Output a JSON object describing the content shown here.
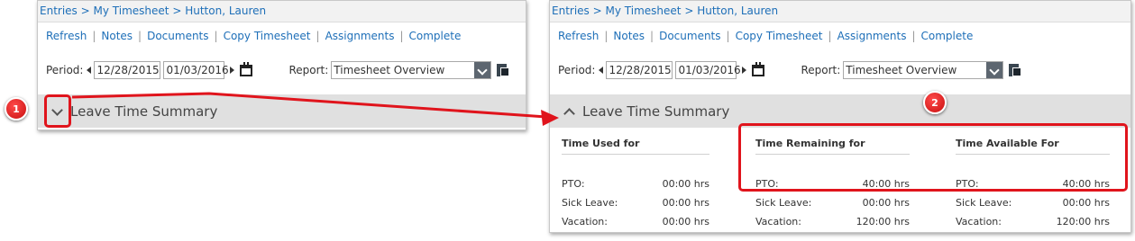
{
  "breadcrumb": {
    "entries": "Entries",
    "sep": ">",
    "my_timesheet": "My Timesheet",
    "person": "Hutton, Lauren"
  },
  "nav_links": [
    "Refresh",
    "Notes",
    "Documents",
    "Copy Timesheet",
    "Assignments",
    "Complete"
  ],
  "nav_separator": "|",
  "period": {
    "label": "Period:",
    "start": "12/28/2015",
    "end": "01/03/2016"
  },
  "report": {
    "label": "Report:",
    "selected": "Timesheet Overview"
  },
  "section": {
    "title": "Leave Time Summary",
    "collapsed_state_left": "collapsed",
    "expanded_state_right": "expanded"
  },
  "summary": {
    "columns": [
      {
        "heading": "Time Used for",
        "rows": [
          {
            "label": "PTO:",
            "value": "00:00 hrs"
          },
          {
            "label": "Sick Leave:",
            "value": "00:00 hrs"
          },
          {
            "label": "Vacation:",
            "value": "00:00 hrs"
          }
        ]
      },
      {
        "heading": "Time Remaining for",
        "rows": [
          {
            "label": "PTO:",
            "value": "40:00 hrs"
          },
          {
            "label": "Sick Leave:",
            "value": "00:00 hrs"
          },
          {
            "label": "Vacation:",
            "value": "120:00 hrs"
          }
        ]
      },
      {
        "heading": "Time Available For",
        "rows": [
          {
            "label": "PTO:",
            "value": "40:00 hrs"
          },
          {
            "label": "Sick Leave:",
            "value": "00:00 hrs"
          },
          {
            "label": "Vacation:",
            "value": "120:00 hrs"
          }
        ]
      }
    ]
  },
  "annotations": {
    "step1": "1",
    "step2": "2",
    "highlight_color": "#e0141c",
    "link_color": "#1e6fb8"
  }
}
